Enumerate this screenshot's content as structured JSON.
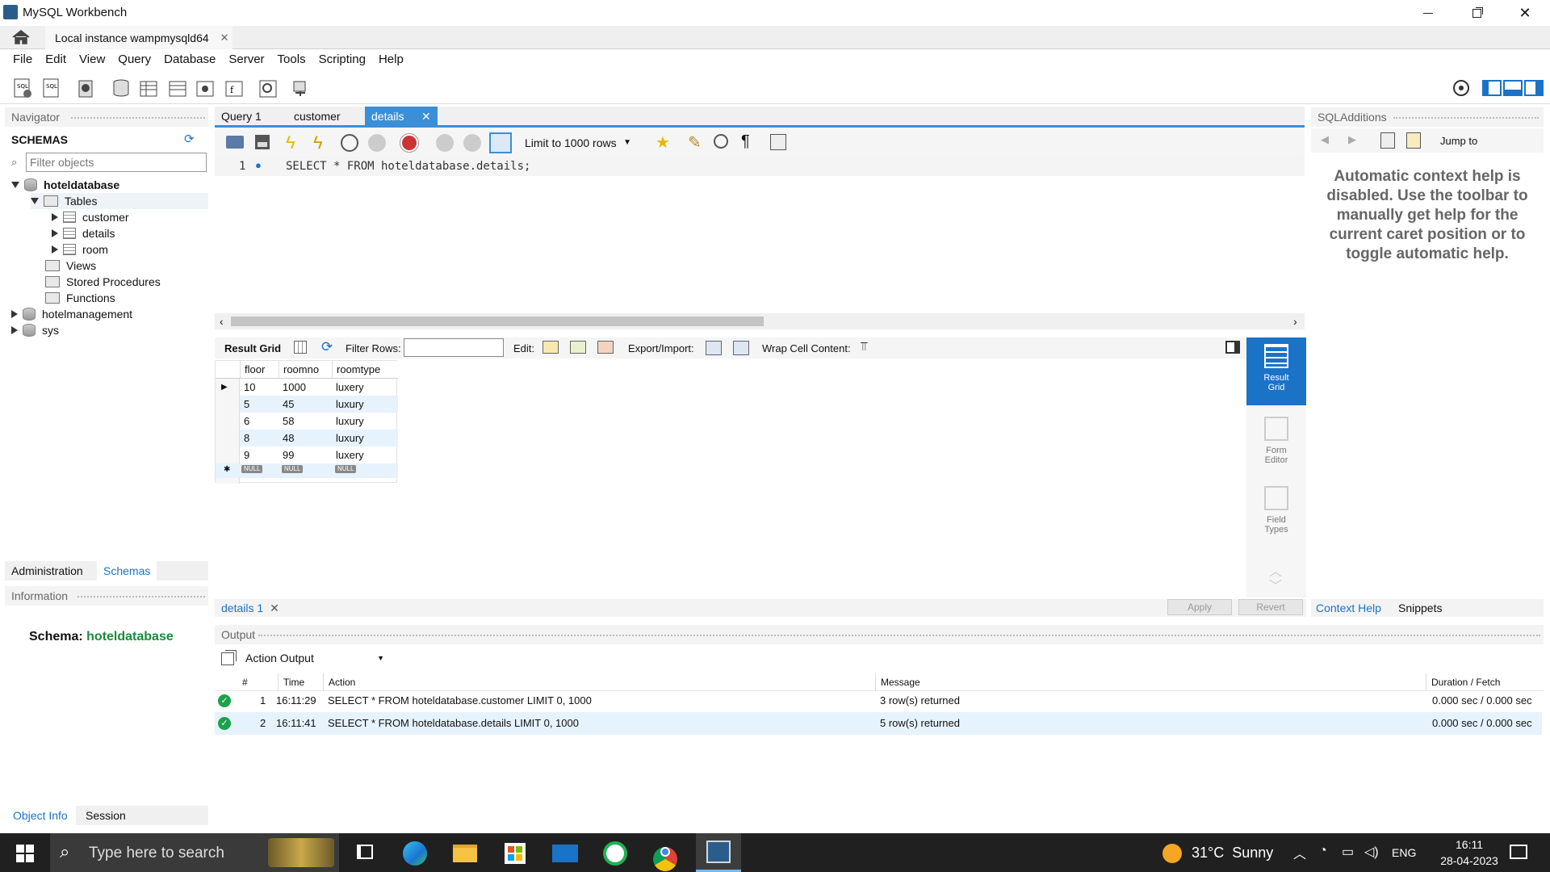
{
  "window": {
    "title": "MySQL Workbench"
  },
  "connection_tab": {
    "label": "Local instance wampmysqld64"
  },
  "menu": [
    "File",
    "Edit",
    "View",
    "Query",
    "Database",
    "Server",
    "Tools",
    "Scripting",
    "Help"
  ],
  "navigator": {
    "header": "Navigator",
    "schemas_label": "SCHEMAS",
    "filter_placeholder": "Filter objects",
    "db_main": "hoteldatabase",
    "tables_label": "Tables",
    "tables": [
      "customer",
      "details",
      "room"
    ],
    "views": "Views",
    "procedures": "Stored Procedures",
    "functions": "Functions",
    "db2": "hotelmanagement",
    "db3": "sys",
    "tab_admin": "Administration",
    "tab_schemas": "Schemas"
  },
  "info": {
    "header": "Information",
    "schema_label": "Schema:",
    "schema_value": "hoteldatabase",
    "tab_object": "Object Info",
    "tab_session": "Session"
  },
  "query_tabs": [
    "Query 1",
    "customer",
    "details"
  ],
  "editor_toolbar": {
    "limit": "Limit to 1000 rows"
  },
  "editor": {
    "line_no": "1",
    "sql": "SELECT * FROM hoteldatabase.details;"
  },
  "result_toolbar": {
    "result_grid": "Result Grid",
    "filter_rows": "Filter Rows:",
    "edit": "Edit:",
    "export_import": "Export/Import:",
    "wrap": "Wrap Cell Content:"
  },
  "grid": {
    "columns": [
      "floor",
      "roomno",
      "roomtype"
    ],
    "rows": [
      [
        "10",
        "1000",
        "luxery"
      ],
      [
        "5",
        "45",
        "luxury"
      ],
      [
        "6",
        "58",
        "luxury"
      ],
      [
        "8",
        "48",
        "luxury"
      ],
      [
        "9",
        "99",
        "luxery"
      ]
    ],
    "null": "NULL"
  },
  "side_panel": {
    "result_grid": "Result Grid",
    "form_editor": "Form Editor",
    "field_types": "Field Types"
  },
  "result_tab": {
    "label": "details 1",
    "apply": "Apply",
    "revert": "Revert"
  },
  "sql_additions": {
    "header": "SQLAdditions",
    "jump_to": "Jump to",
    "help_text": "Automatic context help is disabled. Use the toolbar to manually get help for the current caret position or to toggle automatic help.",
    "tab_context": "Context Help",
    "tab_snippets": "Snippets"
  },
  "output": {
    "header": "Output",
    "selector": "Action Output",
    "columns": [
      "#",
      "Time",
      "Action",
      "Message",
      "Duration / Fetch"
    ],
    "rows": [
      {
        "n": "1",
        "time": "16:11:29",
        "action": "SELECT * FROM hoteldatabase.customer LIMIT 0, 1000",
        "message": "3 row(s) returned",
        "duration": "0.000 sec / 0.000 sec"
      },
      {
        "n": "2",
        "time": "16:11:41",
        "action": "SELECT * FROM hoteldatabase.details LIMIT 0, 1000",
        "message": "5 row(s) returned",
        "duration": "0.000 sec / 0.000 sec"
      }
    ]
  },
  "taskbar": {
    "search": "Type here to search",
    "weather": "31°C  Sunny",
    "lang": "ENG",
    "time": "16:11",
    "date": "28-04-2023"
  },
  "colors": {
    "accent": "#1a73c7",
    "selected_tab": "#3b8fd6",
    "green": "#1a8a3a"
  }
}
